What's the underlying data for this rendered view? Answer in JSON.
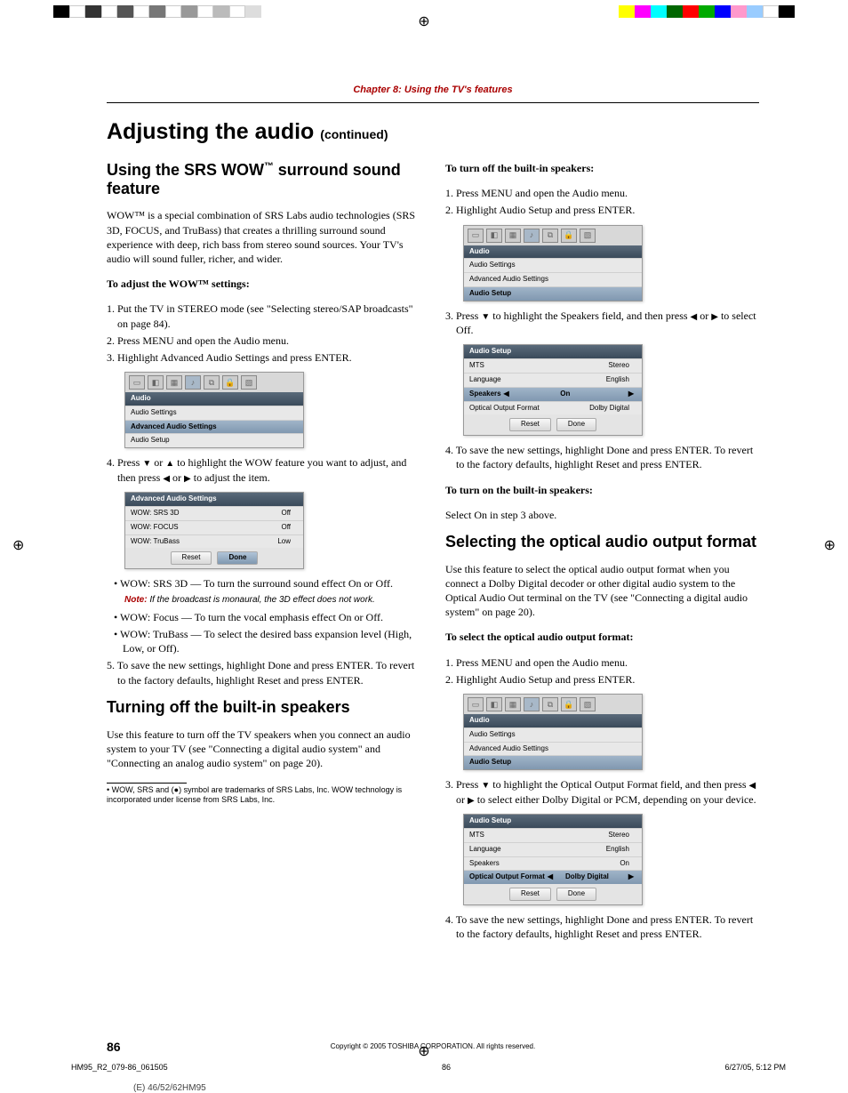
{
  "chapter": "Chapter 8: Using the TV's features",
  "title_main": "Adjusting the audio",
  "title_cont": "(continued)",
  "left": {
    "h_wow_a": "Using the SRS WOW",
    "h_wow_b": " surround sound feature",
    "tm": "™",
    "intro": "WOW™ is a special combination of SRS Labs audio technologies (SRS 3D, FOCUS, and TruBass) that creates a thrilling surround sound experience with deep, rich bass from stereo sound sources. Your TV's audio will sound fuller, richer, and wider.",
    "adj_head": "To adjust the WOW™ settings:",
    "s1": "1. Put the TV in STEREO mode (see \"Selecting stereo/SAP broadcasts\" on page 84).",
    "s2": "2. Press MENU and open the Audio menu.",
    "s3": "3. Highlight Advanced Audio Settings and press ENTER.",
    "s4a": "4. Press ",
    "s4b": " or ",
    "s4c": " to highlight the WOW feature you want to adjust, and then press ",
    "s4d": " or ",
    "s4e": " to adjust the item.",
    "b1": "• WOW: SRS 3D — To turn the surround sound effect On or Off.",
    "note_lbl": "Note:",
    "note_txt": " If the broadcast is monaural, the 3D effect does not work.",
    "b2": "• WOW: Focus — To turn the vocal emphasis effect On or Off.",
    "b3": "• WOW: TruBass — To select the desired bass expansion level (High, Low, or Off).",
    "s5": "5. To save the new settings, highlight Done and press ENTER. To revert to the factory defaults, highlight Reset and press ENTER.",
    "h_spk": "Turning off the built-in speakers",
    "spk_intro": "Use this feature to turn off the TV speakers when you connect an audio system to your TV (see \"Connecting a digital audio system\" and \"Connecting an analog audio system\" on page 20).",
    "fn": "• WOW, SRS and (●) symbol are trademarks of SRS Labs, Inc. WOW technology is incorporated under license from SRS Labs, Inc."
  },
  "right": {
    "off_head": "To turn off the built-in speakers:",
    "o1": "1. Press MENU and open the Audio menu.",
    "o2": "2. Highlight Audio Setup and press ENTER.",
    "o3a": "3. Press ",
    "o3b": " to highlight the Speakers field, and then press ",
    "o3c": " or ",
    "o3d": " to select Off.",
    "o4": "4. To save the new settings, highlight Done and press ENTER. To revert to the factory defaults, highlight Reset and press ENTER.",
    "on_head": "To turn on the built-in speakers:",
    "on_txt": "Select On in step 3 above.",
    "h_opt": "Selecting the optical audio output format",
    "opt_intro": "Use this feature to select the optical audio output format when you connect a Dolby Digital decoder or other digital audio system to the Optical Audio Out terminal on the TV (see \"Connecting a digital audio system\" on page 20).",
    "sel_head": "To select the optical audio output format:",
    "p1": "1. Press MENU and open the Audio menu.",
    "p2": "2. Highlight Audio Setup and press ENTER.",
    "p3a": "3. Press ",
    "p3b": " to highlight the Optical Output Format field, and then press ",
    "p3c": " or ",
    "p3d": " to select either Dolby Digital or PCM, depending on your device.",
    "p4": "4. To save the new settings, highlight Done and press ENTER. To revert to the factory defaults, highlight Reset and press ENTER."
  },
  "menu": {
    "audio": "Audio",
    "au_set": "Audio Settings",
    "adv": "Advanced Audio Settings",
    "setup": "Audio Setup",
    "w3d": "WOW: SRS 3D",
    "wfoc": "WOW: FOCUS",
    "wtb": "WOW: TruBass",
    "off": "Off",
    "low": "Low",
    "on": "On",
    "reset": "Reset",
    "done": "Done",
    "as_hdr": "Audio Setup",
    "mts": "MTS",
    "stereo": "Stereo",
    "lang": "Language",
    "eng": "English",
    "spk": "Speakers",
    "oof": "Optical Output Format",
    "dd": "Dolby Digital"
  },
  "copyright": "Copyright © 2005 TOSHIBA CORPORATION. All rights reserved.",
  "page_num": "86",
  "meta_file": "HM95_R2_079-86_061505",
  "meta_page": "86",
  "meta_date": "6/27/05, 5:12 PM",
  "model": "(E) 46/52/62HM95"
}
